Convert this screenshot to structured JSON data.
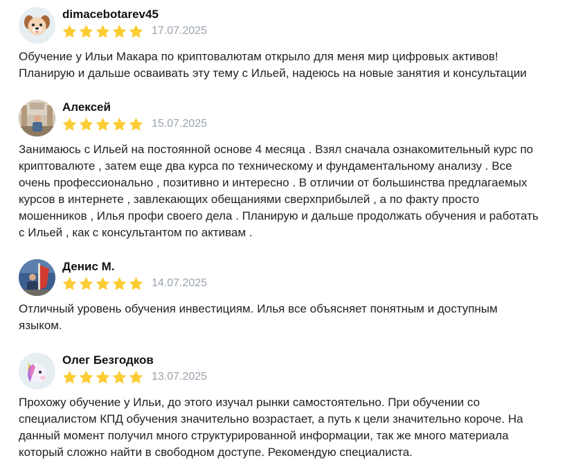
{
  "colors": {
    "star": "#fccc33",
    "date": "#9aa3ad",
    "text": "#222222",
    "name": "#111111"
  },
  "reviews": [
    {
      "author": "dimacebotarev45",
      "avatar_icon": "dog-emoji-avatar",
      "rating": 5,
      "date": "17.07.2025",
      "text": "Обучение у Ильи Макара по криптовалютам открыло для меня мир цифровых активов!\nПланирую и дальше осваивать эту тему с Ильей, надеюсь на новые занятия и консультации"
    },
    {
      "author": "Алексей",
      "avatar_icon": "user-photo-avatar",
      "rating": 5,
      "date": "15.07.2025",
      "text": "Занимаюсь с Ильей на постоянной основе 4 месяца . Взял сначала ознакомительный курс по\nкриптовалюте , затем еще два курса по техническому и фундаментальному анализу . Все\nочень профессионально , позитивно и интересно . В отличии от большинства предлагаемых\nкурсов в интернете , завлекающих обещаниями сверхприбылей , а по факту просто\nмошенников , Илья профи своего дела . Планирую и дальше продолжать обучения и работать\nс Ильей , как с консультантом по активам ."
    },
    {
      "author": "Денис М.",
      "avatar_icon": "user-photo-avatar",
      "rating": 5,
      "date": "14.07.2025",
      "text": "Отличный уровень обучения инвестициям. Илья все объясняет понятным и доступным\nязыком."
    },
    {
      "author": "Олег Безгодков",
      "avatar_icon": "unicorn-emoji-avatar",
      "rating": 5,
      "date": "13.07.2025",
      "text": "Прохожу обучение у Ильи, до этого изучал рынки самостоятельно. При обучении со\nспециалистом КПД обучения значительно возрастает, а путь к цели значительно короче. На\nданный момент получил много структурированной информации, так же много материала\nкоторый сложно найти в свободном доступе. Рекомендую специалиста."
    }
  ]
}
